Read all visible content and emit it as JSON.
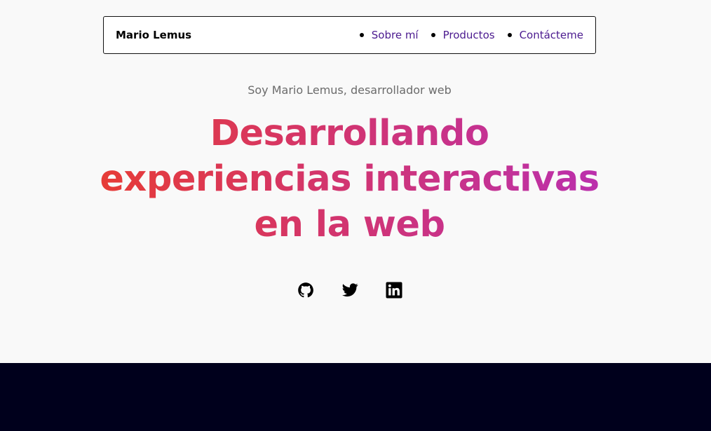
{
  "header": {
    "brand": "Mario Lemus",
    "nav": [
      {
        "label": "Sobre mí"
      },
      {
        "label": "Productos"
      },
      {
        "label": "Contácteme"
      }
    ]
  },
  "hero": {
    "subtitle": "Soy Mario Lemus, desarrollador web",
    "headline_lines": [
      "Desarrollando",
      "experiencias interactivas",
      "en la web"
    ]
  },
  "social": [
    {
      "icon": "github-icon"
    },
    {
      "icon": "twitter-icon"
    },
    {
      "icon": "linkedin-icon"
    }
  ],
  "colors": {
    "background": "#f9f9f9",
    "nav_link": "#4b1a8f",
    "gradient_start": "#ef3f1f",
    "gradient_mid": "#d4356a",
    "gradient_end": "#b22ec4",
    "dark_section": "#00001c"
  }
}
